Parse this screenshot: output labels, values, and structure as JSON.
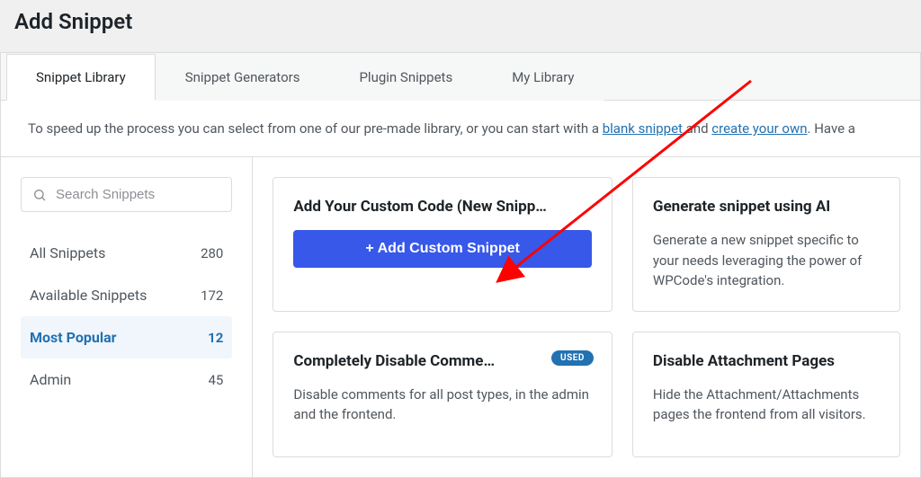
{
  "page_title": "Add Snippet",
  "tabs": [
    {
      "label": "Snippet Library"
    },
    {
      "label": "Snippet Generators"
    },
    {
      "label": "Plugin Snippets"
    },
    {
      "label": "My Library"
    }
  ],
  "intro": {
    "pre": "To speed up the process you can select from one of our pre-made library, or you can start with a ",
    "link1": "blank snippet",
    "mid": " and ",
    "link2": "create your own",
    "post": ". Have a"
  },
  "search": {
    "placeholder": "Search Snippets"
  },
  "categories": [
    {
      "label": "All Snippets",
      "count": "280"
    },
    {
      "label": "Available Snippets",
      "count": "172"
    },
    {
      "label": "Most Popular",
      "count": "12"
    },
    {
      "label": "Admin",
      "count": "45"
    }
  ],
  "cards": {
    "custom": {
      "title": "Add Your Custom Code (New Snipp…",
      "button": "+ Add Custom Snippet"
    },
    "ai": {
      "title": "Generate snippet using AI",
      "desc": "Generate a new snippet specific to your needs leveraging the power of WPCode's integration."
    },
    "disable_comments": {
      "title": "Completely Disable Comme…",
      "badge": "USED",
      "desc": "Disable comments for all post types, in the admin and the frontend."
    },
    "attachment": {
      "title": "Disable Attachment Pages",
      "desc": "Hide the Attachment/Attachments pages the frontend from all visitors."
    }
  }
}
